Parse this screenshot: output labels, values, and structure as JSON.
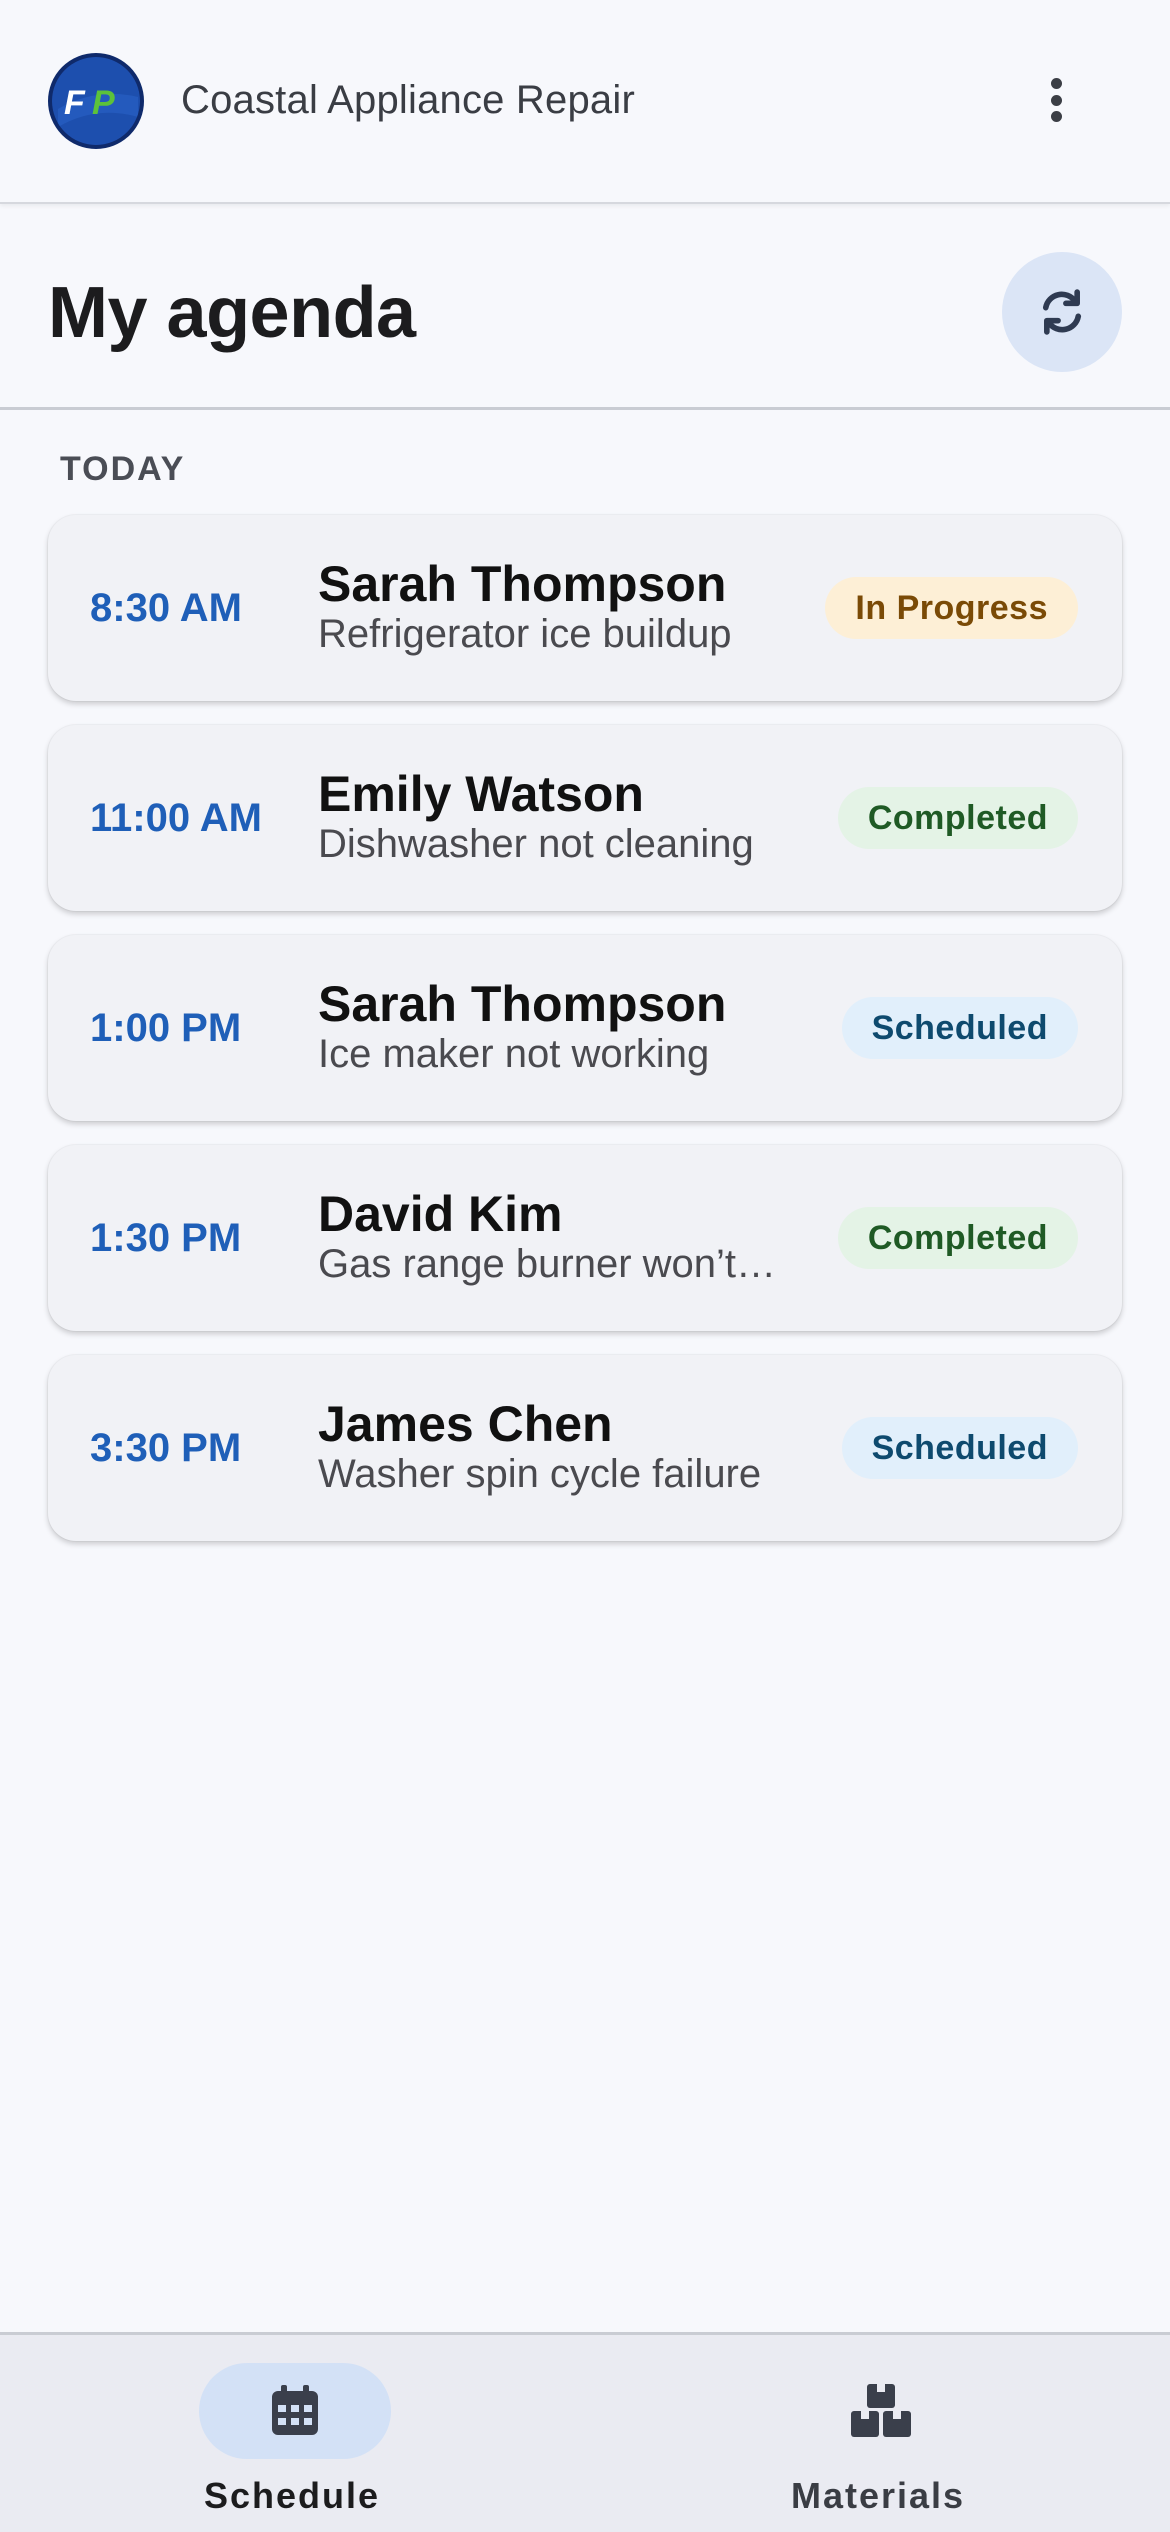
{
  "app": {
    "company_name": "Coastal Appliance Repair",
    "logo_text": "FP"
  },
  "header": {
    "title": "My agenda",
    "refresh_icon": "refresh-icon"
  },
  "section": {
    "label": "TODAY"
  },
  "appointments": [
    {
      "time": "8:30 AM",
      "name": "Sarah Thompson",
      "description": "Refrigerator ice buildup",
      "status": "In Progress",
      "status_type": "in-progress"
    },
    {
      "time": "11:00 AM",
      "name": "Emily Watson",
      "description": "Dishwasher not cleaning",
      "status": "Completed",
      "status_type": "completed"
    },
    {
      "time": "1:00 PM",
      "name": "Sarah Thompson",
      "description": "Ice maker not working",
      "status": "Scheduled",
      "status_type": "scheduled"
    },
    {
      "time": "1:30 PM",
      "name": "David Kim",
      "description": "Gas range burner won’t…",
      "status": "Completed",
      "status_type": "completed"
    },
    {
      "time": "3:30 PM",
      "name": "James Chen",
      "description": "Washer spin cycle failure",
      "status": "Scheduled",
      "status_type": "scheduled"
    }
  ],
  "nav": {
    "items": [
      {
        "label": "Schedule",
        "icon": "calendar-icon",
        "active": true
      },
      {
        "label": "Materials",
        "icon": "boxes-icon",
        "active": false
      }
    ]
  },
  "colors": {
    "accent": "#1f5fb8",
    "in_progress_bg": "#fdefd6",
    "completed_bg": "#e4f3e6",
    "scheduled_bg": "#e1effb"
  }
}
